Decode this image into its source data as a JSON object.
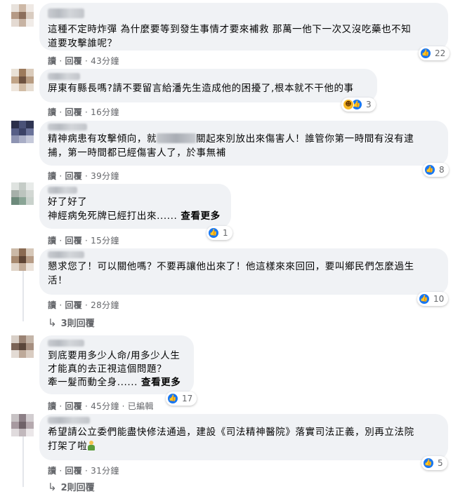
{
  "labels": {
    "read": "讀",
    "reply": "回覆",
    "dot": "·"
  },
  "comments": [
    {
      "text": "這種不定時炸彈 為什麼要等到發生事情才要來補救 那萬一他下一次又沒吃藥也不知\n道要攻擊誰呢？",
      "time": "43分鐘",
      "reactions": "22"
    },
    {
      "text": "屏東有縣長嗎?請不要留言給潘先生造成他的困擾了,根本就不干他的事",
      "time": "16分鐘",
      "reactions": "3"
    },
    {
      "text_before": "精神病患有攻擊傾向，就",
      "text_after": "關起來別放出來傷害人！誰管你第一時間有沒有逮\n捕，第一時間都已經傷害人了，於事無補",
      "time": "39分鐘",
      "reactions": "8"
    },
    {
      "text": "好了好了\n神經病免死牌已經打出來......",
      "see_more": "查看更多",
      "time": "15分鐘",
      "reactions": "1"
    },
    {
      "text": "懇求您了！可以關他嗎？不要再讓他出來了！他這樣來來回回，要叫鄉民們怎麼過生\n活！",
      "time": "28分鐘",
      "reactions": "10",
      "replies": "3則回覆"
    },
    {
      "text": "到底要用多少人命/用多少人生\n才能真的去正視這個問題？\n牽一髮而動全身......",
      "see_more": "查看更多",
      "time": "45分鐘",
      "edited": "已編輯",
      "reactions": "17"
    },
    {
      "text": "希望請公立委們能盡快修法通過，建設《司法精神醫院》落實司法正義，別再立法院\n打架了啦",
      "time": "31分鐘",
      "reactions": "5",
      "replies": "2則回覆"
    }
  ],
  "colors": {
    "bubble": "#f0f2f5",
    "like": "#1877f2",
    "meta": "#65676b",
    "text": "#050505"
  }
}
